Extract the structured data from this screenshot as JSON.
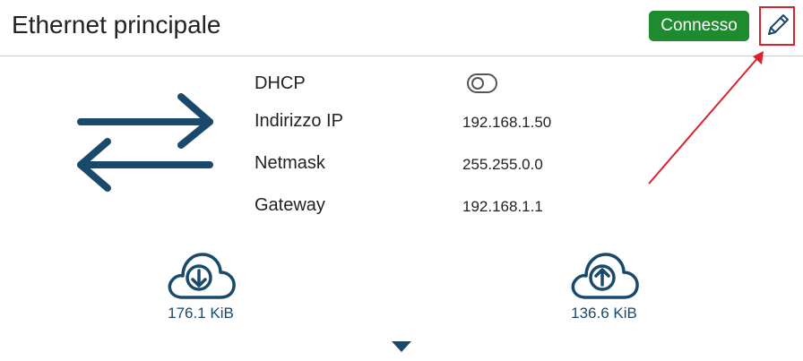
{
  "header": {
    "title": "Ethernet principale",
    "status": "Connesso"
  },
  "fields": {
    "dhcp": {
      "label": "DHCP",
      "enabled": false
    },
    "ip": {
      "label": "Indirizzo IP",
      "value": "192.168.1.50"
    },
    "netmask": {
      "label": "Netmask",
      "value": "255.255.0.0"
    },
    "gateway": {
      "label": "Gateway",
      "value": "192.168.1.1"
    }
  },
  "traffic": {
    "download": "176.1 KiB",
    "upload": "136.6 KiB"
  },
  "icons": {
    "edit": "pencil-icon",
    "transfer": "transfer-arrows-icon",
    "download": "cloud-download-icon",
    "upload": "cloud-upload-icon",
    "expand": "triangle-down-icon"
  },
  "colors": {
    "primary": "#1a4a6b",
    "success": "#1e8c2e",
    "highlight": "#d9232e"
  }
}
